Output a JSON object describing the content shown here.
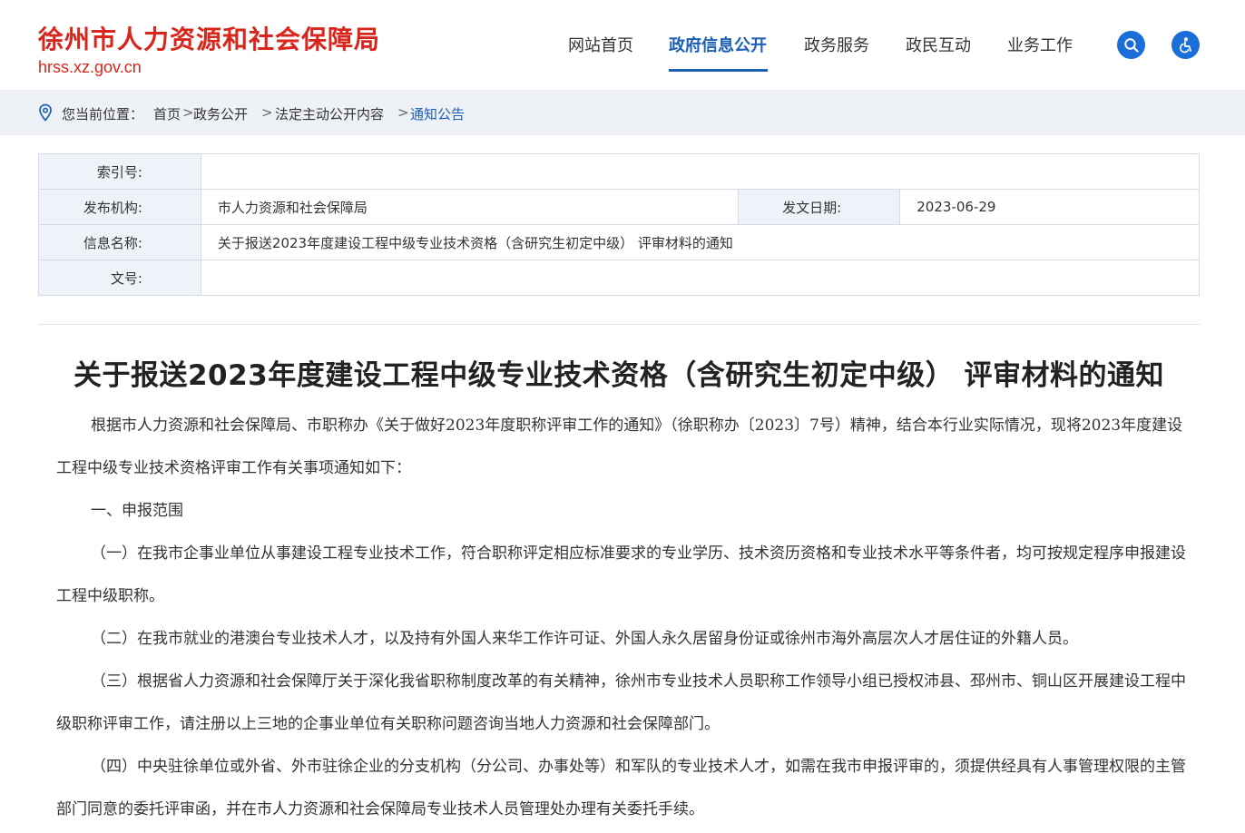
{
  "header": {
    "site_title": "徐州市人力资源和社会保障局",
    "site_domain": "hrss.xz.gov.cn",
    "nav": [
      {
        "label": "网站首页",
        "active": false
      },
      {
        "label": "政府信息公开",
        "active": true
      },
      {
        "label": "政务服务",
        "active": false
      },
      {
        "label": "政民互动",
        "active": false
      },
      {
        "label": "业务工作",
        "active": false
      }
    ],
    "search_icon": "search-icon",
    "accessibility_icon": "accessibility-icon",
    "accent_color": "#1a5fb4",
    "brand_color": "#d9261c"
  },
  "breadcrumb": {
    "prefix": "您当前位置：",
    "items": [
      "首页",
      "政务公开",
      "法定主动公开内容",
      "通知公告"
    ],
    "separators": [
      ">",
      ">",
      ">"
    ]
  },
  "info": {
    "index_label": "索引号:",
    "index_value": "",
    "publisher_label": "发布机构:",
    "publisher_value": "市人力资源和社会保障局",
    "date_label": "发文日期:",
    "date_value": "2023-06-29",
    "name_label": "信息名称:",
    "name_value": "关于报送2023年度建设工程中级专业技术资格（含研究生初定中级） 评审材料的通知",
    "doc_no_label": "文号:",
    "doc_no_value": ""
  },
  "article": {
    "title": "关于报送2023年度建设工程中级专业技术资格（含研究生初定中级） 评审材料的通知",
    "paragraphs": [
      "根据市人力资源和社会保障局、市职称办《关于做好2023年度职称评审工作的通知》（徐职称办〔2023〕7号）精神，结合本行业实际情况，现将2023年度建设工程中级专业技术资格评审工作有关事项通知如下：",
      "一、申报范围",
      "（一）在我市企事业单位从事建设工程专业技术工作，符合职称评定相应标准要求的专业学历、技术资历资格和专业技术水平等条件者，均可按规定程序申报建设工程中级职称。",
      "（二）在我市就业的港澳台专业技术人才，以及持有外国人来华工作许可证、外国人永久居留身份证或徐州市海外高层次人才居住证的外籍人员。",
      "（三）根据省人力资源和社会保障厅关于深化我省职称制度改革的有关精神，徐州市专业技术人员职称工作领导小组已授权沛县、邳州市、铜山区开展建设工程中级职称评审工作，请注册以上三地的企事业单位有关职称问题咨询当地人力资源和社会保障部门。",
      "（四）中央驻徐单位或外省、外市驻徐企业的分支机构（分公司、办事处等）和军队的专业技术人才，如需在我市申报评审的，须提供经具有人事管理权限的主管部门同意的委托评审函，并在市人力资源和社会保障局专业技术人员管理处办理有关委托手续。"
    ]
  }
}
